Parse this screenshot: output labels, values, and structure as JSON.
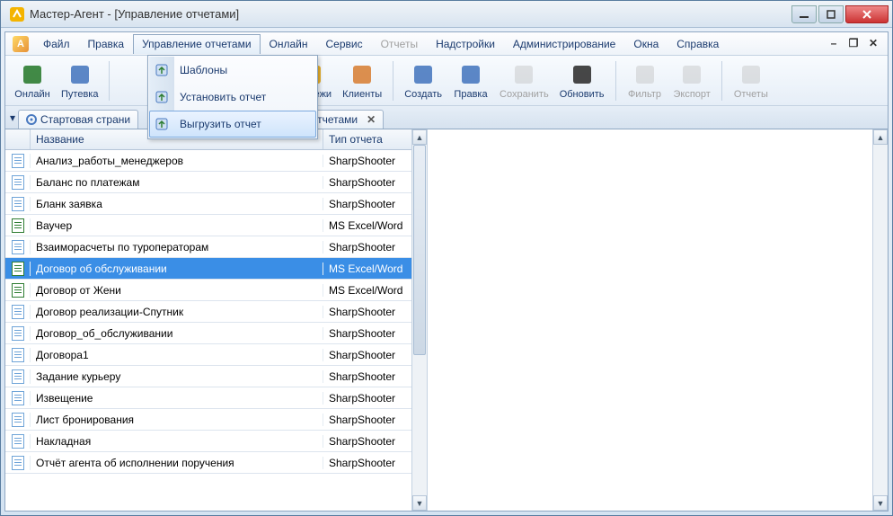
{
  "window": {
    "title": "Мастер-Агент - [Управление отчетами]"
  },
  "menu": {
    "items": [
      "Файл",
      "Правка",
      "Управление отчетами",
      "Онлайн",
      "Сервис",
      "Отчеты",
      "Надстройки",
      "Администрирование",
      "Окна",
      "Справка"
    ],
    "open_index": 2,
    "disabled_index": 5
  },
  "dropdown": {
    "items": [
      {
        "label": "Шаблоны",
        "icon": "template-icon"
      },
      {
        "label": "Установить отчет",
        "icon": "install-icon"
      },
      {
        "label": "Выгрузить отчет",
        "icon": "export-icon",
        "hover": true
      }
    ]
  },
  "toolbar": {
    "buttons": [
      {
        "label": "Онлайн",
        "icon": "globe-icon",
        "color": "#2e7d32"
      },
      {
        "label": "Путевка",
        "icon": "ticket-icon",
        "color": "#4a7ac0"
      }
    ],
    "buttons2": [
      {
        "label": "Платежи",
        "icon": "coins-icon",
        "color": "#e6a817"
      },
      {
        "label": "Клиенты",
        "icon": "people-icon",
        "color": "#d8833b"
      }
    ],
    "buttons3": [
      {
        "label": "Создать",
        "icon": "new-icon",
        "color": "#4a7ac0"
      },
      {
        "label": "Правка",
        "icon": "edit-icon",
        "color": "#4a7ac0"
      },
      {
        "label": "Сохранить",
        "icon": "save-icon",
        "disabled": true
      },
      {
        "label": "Обновить",
        "icon": "refresh-icon",
        "color": "#333"
      }
    ],
    "buttons4": [
      {
        "label": "Фильтр",
        "icon": "filter-icon",
        "disabled": true
      },
      {
        "label": "Экспорт",
        "icon": "export2-icon",
        "disabled": true
      }
    ],
    "buttons5": [
      {
        "label": "Отчеты",
        "icon": "reports-icon",
        "disabled": true
      }
    ]
  },
  "tabs": {
    "tab1_partial": "Стартовая страни",
    "tab2_partial": "тчетами"
  },
  "grid": {
    "col_name": "Название",
    "col_type": "Тип отчета",
    "rows": [
      {
        "name": "Анализ_работы_менеджеров",
        "type": "SharpShooter",
        "kind": "ss"
      },
      {
        "name": "Баланс по платежам",
        "type": "SharpShooter",
        "kind": "ss"
      },
      {
        "name": "Бланк заявка",
        "type": "SharpShooter",
        "kind": "ss"
      },
      {
        "name": "Ваучер",
        "type": "MS Excel/Word",
        "kind": "xl"
      },
      {
        "name": "Взаиморасчеты по туроператорам",
        "type": "SharpShooter",
        "kind": "ss"
      },
      {
        "name": "Договор об обслуживании",
        "type": "MS Excel/Word",
        "kind": "xl",
        "selected": true
      },
      {
        "name": "Договор от Жени",
        "type": "MS Excel/Word",
        "kind": "xl"
      },
      {
        "name": "Договор реализации-Спутник",
        "type": "SharpShooter",
        "kind": "ss"
      },
      {
        "name": "Договор_об_обслуживании",
        "type": "SharpShooter",
        "kind": "ss"
      },
      {
        "name": "Договора1",
        "type": "SharpShooter",
        "kind": "ss"
      },
      {
        "name": "Задание курьеру",
        "type": "SharpShooter",
        "kind": "ss"
      },
      {
        "name": "Извещение",
        "type": "SharpShooter",
        "kind": "ss"
      },
      {
        "name": "Лист бронирования",
        "type": "SharpShooter",
        "kind": "ss"
      },
      {
        "name": "Накладная",
        "type": "SharpShooter",
        "kind": "ss"
      },
      {
        "name": "Отчёт агента об исполнении поручения",
        "type": "SharpShooter",
        "kind": "ss"
      }
    ]
  }
}
